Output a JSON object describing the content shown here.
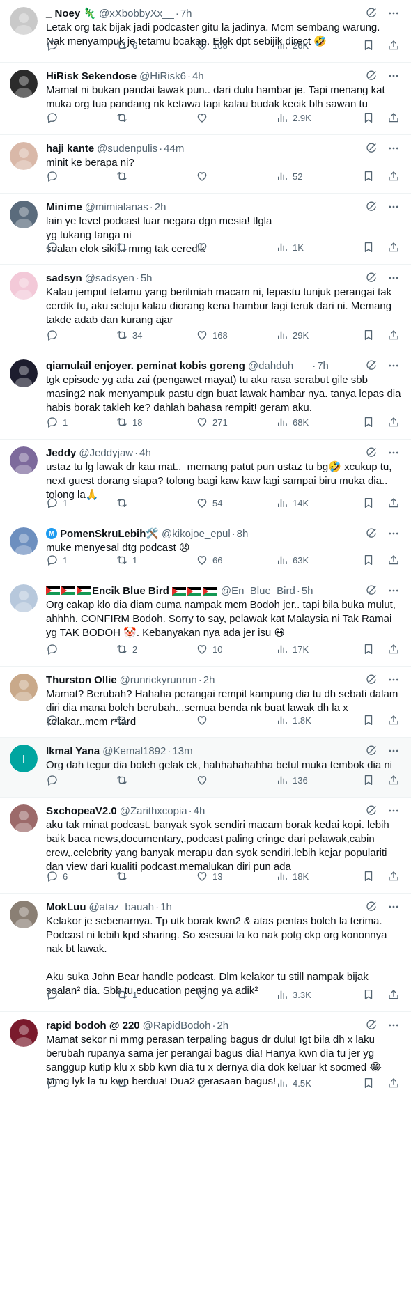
{
  "colors": {
    "text": "#0f1419",
    "muted": "#536471",
    "border": "#eff3f4",
    "accent": "#1d9bf0"
  },
  "icons": {
    "reply": "reply-icon",
    "retweet": "retweet-icon",
    "like": "heart-icon",
    "views": "views-chart-icon",
    "bookmark": "bookmark-icon",
    "share": "share-icon",
    "grok": "grok-icon",
    "more": "more-icon"
  },
  "tweets": [
    {
      "name": "_ Noey 🦎",
      "handle": "@xXbobbyXx__",
      "time": "7h",
      "text": "Letak org tak bijak jadi podcaster gitu la jadinya. Mcm sembang warung. Nak menyampuk je tetamu bcakap. Elok dpt sebijik direct 🤣",
      "reply": "",
      "retweet": "6",
      "like": "108",
      "views": "26K"
    },
    {
      "name": "HiRisk Sekendose",
      "handle": "@HiRisk6",
      "time": "4h",
      "text": "Mamat ni bukan pandai lawak pun.. dari dulu hambar je. Tapi menang kat muka org tua pandang nk ketawa tapi kalau budak kecik blh sawan tu",
      "reply": "",
      "retweet": "",
      "like": "",
      "views": "2.9K"
    },
    {
      "name": "haji kante",
      "handle": "@sudenpulis",
      "time": "44m",
      "text": "minit ke berapa ni?",
      "reply": "",
      "retweet": "",
      "like": "",
      "views": "52"
    },
    {
      "name": "Minime",
      "handle": "@mimialanas",
      "time": "2h",
      "text": "lain ye level podcast luar negara dgn mesia! tlgla\nyg tukang tanga ni\nsoalan elok sikit.. mmg tak ceredik",
      "reply": "",
      "retweet": "",
      "like": "",
      "views": "1K"
    },
    {
      "name": "sadsyn",
      "handle": "@sadsyen",
      "time": "5h",
      "text": "Kalau jemput tetamu yang berilmiah macam ni, lepastu tunjuk perangai tak cerdik tu, aku setuju kalau diorang kena hambur lagi teruk dari ni. Memang takde adab dan kurang ajar",
      "reply": "",
      "retweet": "34",
      "like": "168",
      "views": "29K"
    },
    {
      "name": "qiamulail enjoyer. peminat kobis goreng",
      "handle": "@dahduh___",
      "time": "7h",
      "text": "tgk episode yg ada zai (pengawet mayat) tu aku rasa serabut gile sbb masing2 nak menyampuk pastu dgn buat lawak hambar nya. tanya lepas dia habis borak takleh ke? dahlah bahasa rempit! geram aku.",
      "reply": "1",
      "retweet": "18",
      "like": "271",
      "views": "68K"
    },
    {
      "name": "Jeddy",
      "handle": "@Jeddyjaw",
      "time": "4h",
      "text": "ustaz tu lg lawak dr kau mat..  memang patut pun ustaz tu bg🤣 xcukup tu, next guest dorang siapa? tolong bagi kaw kaw lagi sampai biru muka dia.. tolong la🙏",
      "reply": "1",
      "retweet": "",
      "like": "54",
      "views": "14K"
    },
    {
      "name": "PomenSkruLebih🛠️",
      "handle": "@kikojoe_epul",
      "time": "8h",
      "text": "muke menyesal dtg podcast 😠",
      "reply": "1",
      "retweet": "1",
      "like": "66",
      "views": "63K"
    },
    {
      "name": "Encik Blue Bird",
      "handle": "@En_Blue_Bird",
      "time": "5h",
      "text": "Org cakap klo dia diam cuma nampak mcm Bodoh jer.. tapi bila buka mulut, ahhhh. CONFIRM Bodoh. Sorry to say, pelawak kat Malaysia ni Tak Ramai yg TAK BODOH 🤡. Kebanyakan nya ada jer isu 😷",
      "reply": "",
      "retweet": "2",
      "like": "10",
      "views": "17K"
    },
    {
      "name": "Thurston Ollie",
      "handle": "@runrickyrunrun",
      "time": "2h",
      "text": "Mamat? Berubah? Hahaha perangai rempit kampung dia tu dh sebati dalam diri dia mana boleh berubah...semua benda nk buat lawak dh la x kelakar..mcm r*tard",
      "reply": "",
      "retweet": "",
      "like": "",
      "views": "1.8K"
    },
    {
      "name": "Ikmal Yana",
      "handle": "@Kemal1892",
      "time": "13m",
      "text": "Org dah tegur dia boleh gelak ek, hahhahahahha betul muka tembok dia ni",
      "reply": "",
      "retweet": "",
      "like": "",
      "views": "136"
    },
    {
      "name": "SxchopeaV2.0",
      "handle": "@Zarithxcopia",
      "time": "4h",
      "text": "aku tak minat podcast. banyak syok sendiri macam borak kedai kopi. lebih baik baca news,documentary,.podcast paling cringe dari pelawak,cabin crew,,celebrity yang banyak merapu dan syok sendiri.lebih kejar populariti dan view dari kualiti podcast.memalukan diri pun ada",
      "reply": "6",
      "retweet": "",
      "like": "13",
      "views": "18K"
    },
    {
      "name": "MokLuu",
      "handle": "@ataz_bauah",
      "time": "1h",
      "text": "Kelakor je sebenarnya. Tp utk borak kwn2 & atas pentas boleh la terima. Podcast ni lebih kpd sharing. So xsesuai la ko nak potg ckp org kononnya nak bt lawak.\n\nAku suka John Bear handle podcast. Dlm kelakor tu still nampak bijak soalan² dia. Sbb tu education penting ya adik²",
      "reply": "",
      "retweet": "1",
      "like": "",
      "views": "3.3K"
    },
    {
      "name": "rapid bodoh @ 220",
      "handle": "@RapidBodoh",
      "time": "2h",
      "text": "Mamat sekor ni mmg perasan terpaling bagus dr dulu! Igt bila dh x laku berubah rupanya sama jer perangai bagus dia! Hanya kwn dia tu jer yg sanggup kutip klu x sbb kwn dia tu x dernya dia dok keluar kt socmed 😂 Mmg lyk la tu kwn berdua! Dua2 perasaan bagus!",
      "reply": "",
      "retweet": "",
      "like": "",
      "views": "4.5K"
    }
  ]
}
